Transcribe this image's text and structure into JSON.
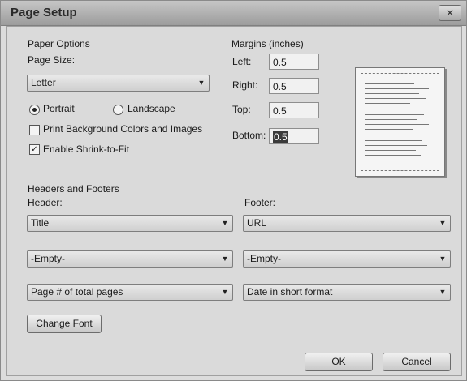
{
  "dialog": {
    "title": "Page Setup",
    "close_glyph": "✕"
  },
  "paper": {
    "section_label": "Paper Options",
    "page_size_label": "Page Size:",
    "page_size_value": "Letter",
    "orientation": {
      "portrait": "Portrait",
      "landscape": "Landscape",
      "selected": "portrait"
    },
    "print_bg_label": "Print Background Colors and Images",
    "print_bg_checked": false,
    "shrink_label": "Enable Shrink-to-Fit",
    "shrink_checked": true,
    "check_glyph": "✓"
  },
  "margins": {
    "section_label": "Margins (inches)",
    "left_label": "Left:",
    "left_value": "0.5",
    "right_label": "Right:",
    "right_value": "0.5",
    "top_label": "Top:",
    "top_value": "0.5",
    "bottom_label": "Bottom:",
    "bottom_value": "0.5"
  },
  "headers_footers": {
    "section_label": "Headers and Footers",
    "header_label": "Header:",
    "footer_label": "Footer:",
    "header": [
      "Title",
      "-Empty-",
      "Page # of total pages"
    ],
    "footer": [
      "URL",
      "-Empty-",
      "Date in short format"
    ]
  },
  "buttons": {
    "change_font": "Change Font",
    "ok": "OK",
    "cancel": "Cancel"
  },
  "icons": {
    "dropdown_arrow": "▼"
  }
}
